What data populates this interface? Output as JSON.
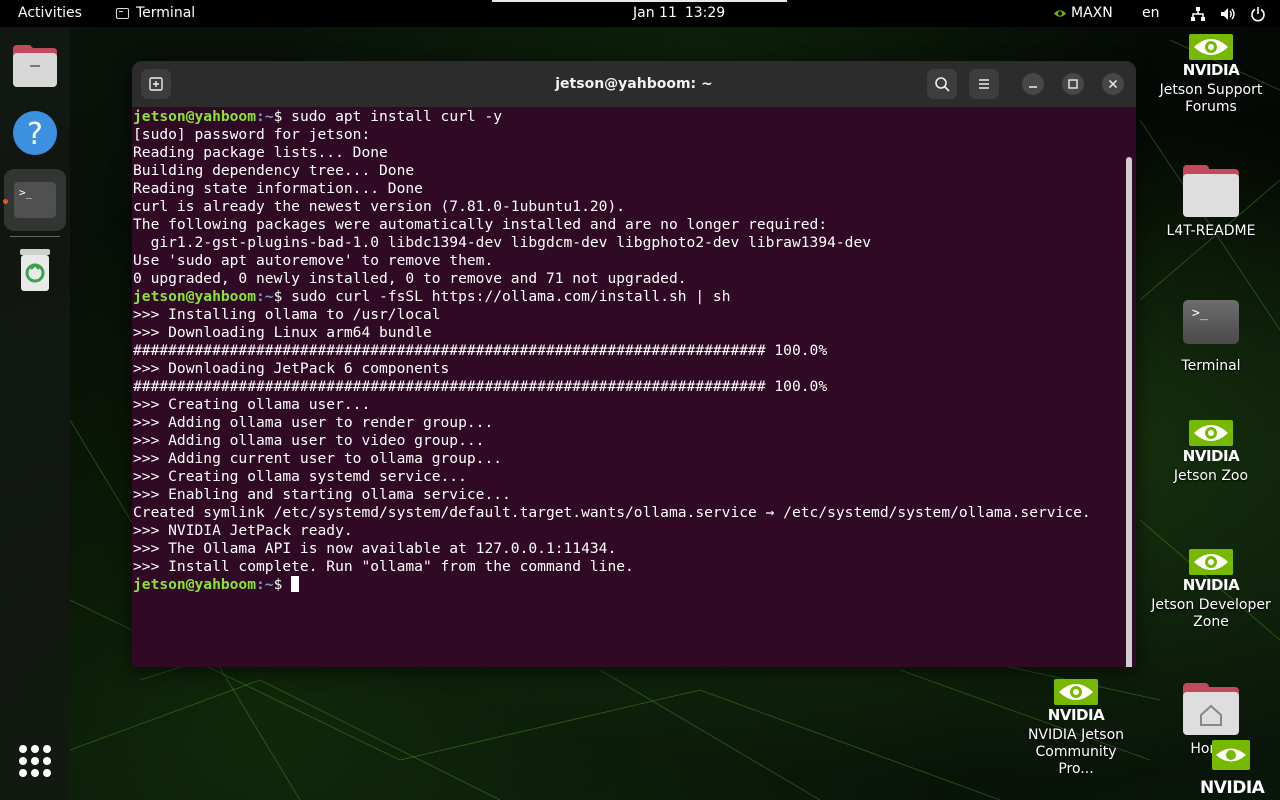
{
  "topbar": {
    "activities": "Activities",
    "app_name": "Terminal",
    "date": "Jan 11",
    "time": "13:29",
    "power_mode": "MAXN",
    "language": "en",
    "tray_icons": [
      "network-icon",
      "volume-icon",
      "power-icon"
    ]
  },
  "dock": {
    "items": [
      "files",
      "help",
      "terminal",
      "trash"
    ],
    "help_glyph": "?",
    "terminal_glyph": ">_"
  },
  "window": {
    "title": "jetson@yahboom: ~",
    "prompt_user": "jetson@yahboom",
    "prompt_path": ":~",
    "prompt_symbol": "$ ",
    "lines": [
      {
        "type": "cmd",
        "text": "sudo apt install curl -y"
      },
      {
        "type": "out",
        "text": "[sudo] password for jetson:"
      },
      {
        "type": "out",
        "text": "Reading package lists... Done"
      },
      {
        "type": "out",
        "text": "Building dependency tree... Done"
      },
      {
        "type": "out",
        "text": "Reading state information... Done"
      },
      {
        "type": "out",
        "text": "curl is already the newest version (7.81.0-1ubuntu1.20)."
      },
      {
        "type": "out",
        "text": "The following packages were automatically installed and are no longer required:"
      },
      {
        "type": "out",
        "text": "  gir1.2-gst-plugins-bad-1.0 libdc1394-dev libgdcm-dev libgphoto2-dev libraw1394-dev"
      },
      {
        "type": "out",
        "text": "Use 'sudo apt autoremove' to remove them."
      },
      {
        "type": "out",
        "text": "0 upgraded, 0 newly installed, 0 to remove and 71 not upgraded."
      },
      {
        "type": "cmd",
        "text": "sudo curl -fsSL https://ollama.com/install.sh | sh"
      },
      {
        "type": "out",
        "text": ">>> Installing ollama to /usr/local"
      },
      {
        "type": "out",
        "text": ">>> Downloading Linux arm64 bundle"
      },
      {
        "type": "out",
        "text": "######################################################################## 100.0%"
      },
      {
        "type": "out",
        "text": ">>> Downloading JetPack 6 components"
      },
      {
        "type": "out",
        "text": "######################################################################## 100.0%"
      },
      {
        "type": "out",
        "text": ">>> Creating ollama user..."
      },
      {
        "type": "out",
        "text": ">>> Adding ollama user to render group..."
      },
      {
        "type": "out",
        "text": ">>> Adding ollama user to video group..."
      },
      {
        "type": "out",
        "text": ">>> Adding current user to ollama group..."
      },
      {
        "type": "out",
        "text": ">>> Creating ollama systemd service..."
      },
      {
        "type": "out",
        "text": ">>> Enabling and starting ollama service..."
      },
      {
        "type": "out",
        "text": "Created symlink /etc/systemd/system/default.target.wants/ollama.service → /etc/systemd/system/ollama.service."
      },
      {
        "type": "out",
        "text": ">>> NVIDIA JetPack ready."
      },
      {
        "type": "out",
        "text": ">>> The Ollama API is now available at 127.0.0.1:11434."
      },
      {
        "type": "out",
        "text": ">>> Install complete. Run \"ollama\" from the command line."
      },
      {
        "type": "cmd",
        "text": ""
      }
    ]
  },
  "desktop": {
    "nvidia_wordmark": "NVIDIA",
    "terminal_glyph": ">_",
    "icons": {
      "support_forums": "Jetson Support Forums",
      "l4t_readme": "L4T-README",
      "terminal": "Terminal",
      "jetson_zoo": "Jetson Zoo",
      "developer_zone": "Jetson Developer Zone",
      "community": "NVIDIA Jetson Community Pro...",
      "home": "Home"
    }
  },
  "colors": {
    "terminal_bg": "#300a24",
    "prompt_user": "#8ae234",
    "prompt_path": "#729fcf",
    "nvidia_green": "#76b900",
    "folder_tab": "#c14a5c"
  }
}
